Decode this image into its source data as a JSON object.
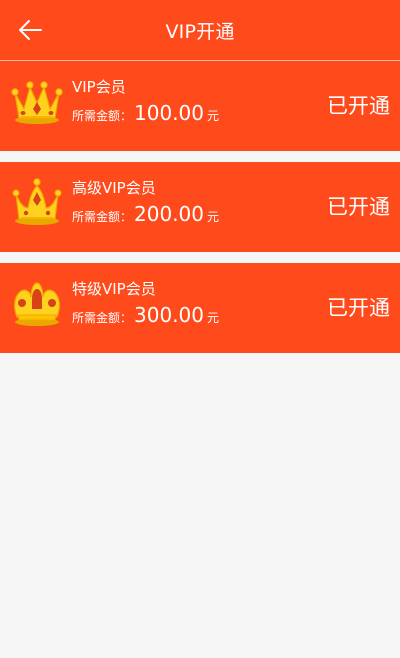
{
  "header": {
    "title": "VIP开通",
    "back_icon": "arrow-left-icon"
  },
  "colors": {
    "brand": "#ff4a1c",
    "background": "#f6f6f6",
    "crown_gold": "#ffd21f",
    "crown_gem": "#d84315"
  },
  "memberships": [
    {
      "name": "VIP会员",
      "price_label": "所需金额：",
      "amount": "100.00",
      "unit": "元",
      "status": "已开通",
      "icon": "crown-icon"
    },
    {
      "name": "高级VIP会员",
      "price_label": "所需金额：",
      "amount": "200.00",
      "unit": "元",
      "status": "已开通",
      "icon": "crown-icon"
    },
    {
      "name": "特级VIP会员",
      "price_label": "所需金额：",
      "amount": "300.00",
      "unit": "元",
      "status": "已开通",
      "icon": "crown-icon"
    }
  ]
}
